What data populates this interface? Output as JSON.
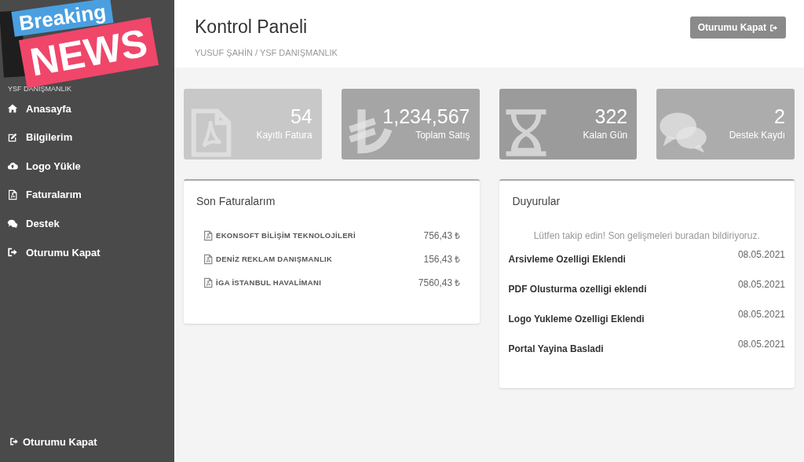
{
  "sticker": {
    "top": "Breaking",
    "bottom": "NEWS"
  },
  "sidebar": {
    "company": "YSF DANIŞMANLIK",
    "items": [
      {
        "label": "Anasayfa"
      },
      {
        "label": "Bilgilerim"
      },
      {
        "label": "Logo Yükle"
      },
      {
        "label": "Faturalarım"
      },
      {
        "label": "Destek"
      },
      {
        "label": "Oturumu Kapat"
      }
    ],
    "footer": "Oturumu Kapat"
  },
  "header": {
    "title": "Kontrol Paneli",
    "breadcrumb": "YUSUF ŞAHİN / YSF DANIŞMANLIK",
    "logout_button": "Oturumu Kapat"
  },
  "stats": [
    {
      "value": "54",
      "label": "Kayıtlı Fatura",
      "color": "#c8c8c8"
    },
    {
      "value": "1,234,567",
      "label": "Toplam Satış",
      "color": "#a5a5a5"
    },
    {
      "value": "322",
      "label": "Kalan Gün",
      "color": "#9b9b9b"
    },
    {
      "value": "2",
      "label": "Destek Kaydı",
      "color": "#acacac"
    }
  ],
  "invoices": {
    "title": "Son Faturalarım",
    "rows": [
      {
        "name": "EKONSOFT BİLİŞİM TEKNOLOJİLERİ",
        "amount": "756,43 ₺"
      },
      {
        "name": "DENİZ REKLAM DANIŞMANLIK",
        "amount": "156,43 ₺"
      },
      {
        "name": "İGA İSTANBUL HAVALİMANI",
        "amount": "7560,43 ₺"
      }
    ]
  },
  "announcements": {
    "title": "Duyurular",
    "intro": "Lütfen takip edin! Son gelişmeleri buradan bildiriyoruz.",
    "items": [
      {
        "title": "Arsivleme Ozelligi Eklendi",
        "date": "08.05.2021"
      },
      {
        "title": "PDF Olusturma ozelligi eklendi",
        "date": "08.05.2021"
      },
      {
        "title": "Logo Yukleme Ozelligi Eklendi",
        "date": "08.05.2021"
      },
      {
        "title": "Portal Yayina Basladi",
        "date": "08.05.2021"
      }
    ]
  }
}
